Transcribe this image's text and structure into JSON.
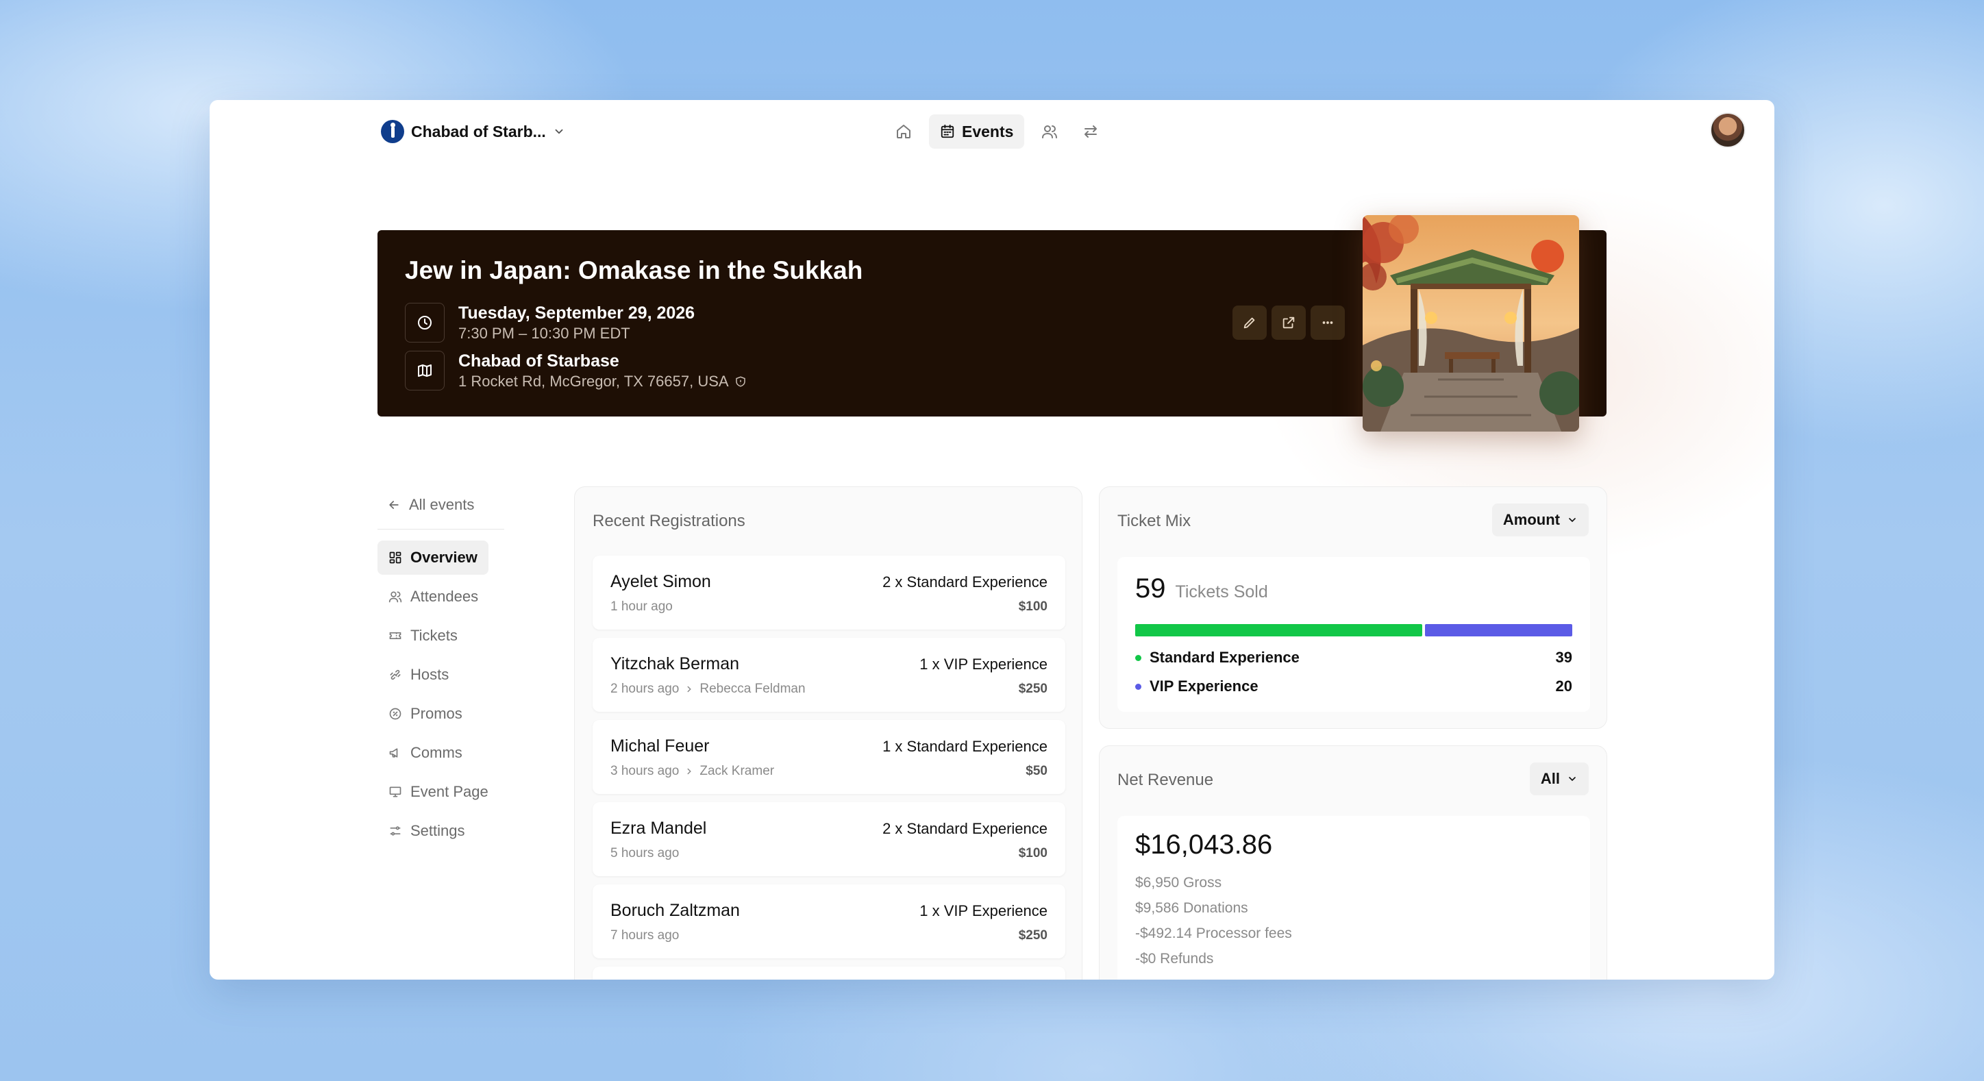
{
  "topbar": {
    "org_name": "Chabad of Starb...",
    "nav_active_label": "Events"
  },
  "event": {
    "title": "Jew in Japan: Omakase in the Sukkah",
    "date": "Tuesday, September 29, 2026",
    "time": "7:30 PM – 10:30 PM EDT",
    "venue": "Chabad of Starbase",
    "address": "1 Rocket Rd, McGregor, TX 76657, USA"
  },
  "sidebar": {
    "back_label": "All events",
    "items": [
      {
        "label": "Overview",
        "icon": "grid-icon"
      },
      {
        "label": "Attendees",
        "icon": "users-icon"
      },
      {
        "label": "Tickets",
        "icon": "ticket-icon"
      },
      {
        "label": "Hosts",
        "icon": "handshake-icon"
      },
      {
        "label": "Promos",
        "icon": "badge-percent-icon"
      },
      {
        "label": "Comms",
        "icon": "megaphone-icon"
      },
      {
        "label": "Event Page",
        "icon": "monitor-icon"
      },
      {
        "label": "Settings",
        "icon": "sliders-icon"
      }
    ]
  },
  "registrations": {
    "title": "Recent Registrations",
    "items": [
      {
        "name": "Ayelet Simon",
        "time": "1 hour ago",
        "referrer": "",
        "ticket": "2 x Standard Experience",
        "amount": "$100"
      },
      {
        "name": "Yitzchak Berman",
        "time": "2 hours ago",
        "referrer": "Rebecca Feldman",
        "ticket": "1 x VIP Experience",
        "amount": "$250"
      },
      {
        "name": "Michal Feuer",
        "time": "3 hours ago",
        "referrer": "Zack Kramer",
        "ticket": "1 x Standard Experience",
        "amount": "$50"
      },
      {
        "name": "Ezra Mandel",
        "time": "5 hours ago",
        "referrer": "",
        "ticket": "2 x Standard Experience",
        "amount": "$100"
      },
      {
        "name": "Boruch Zaltzman",
        "time": "7 hours ago",
        "referrer": "",
        "ticket": "1 x VIP Experience",
        "amount": "$250"
      }
    ]
  },
  "ticket_mix": {
    "title": "Ticket Mix",
    "dropdown": "Amount",
    "total": "59",
    "total_label": "Tickets Sold",
    "series": [
      {
        "label": "Standard Experience",
        "value": 39,
        "display": "39",
        "color": "#12c748"
      },
      {
        "label": "VIP Experience",
        "value": 20,
        "display": "20",
        "color": "#5b5be6"
      }
    ]
  },
  "net_revenue": {
    "title": "Net Revenue",
    "dropdown": "All",
    "total": "$16,043.86",
    "lines": [
      "$6,950 Gross",
      "$9,586 Donations",
      "-$492.14 Processor fees",
      "-$0 Refunds"
    ]
  }
}
